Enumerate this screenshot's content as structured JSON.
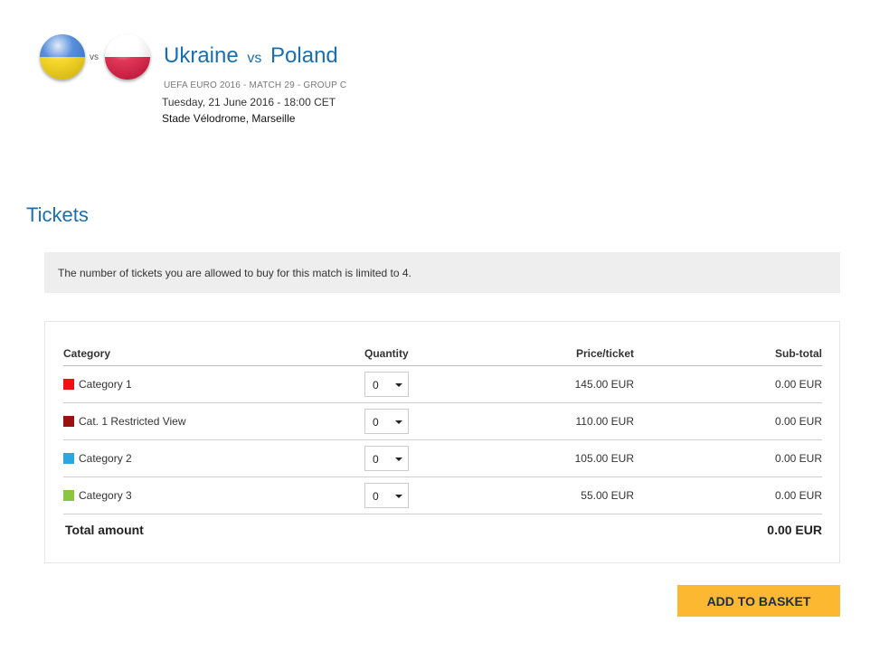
{
  "match": {
    "home_team": "Ukraine",
    "vs_label": "vs",
    "away_team": "Poland",
    "vs_small": "vs",
    "competition": "UEFA EURO 2016 - MATCH 29 - GROUP C",
    "datetime": "Tuesday, 21 June 2016 - 18:00 CET",
    "venue": "Stade Vélodrome, Marseille",
    "home_flag": {
      "icon": "ukraine-flag-icon",
      "colors": [
        "#3a7bd5",
        "#f6d20a"
      ]
    },
    "away_flag": {
      "icon": "poland-flag-icon",
      "colors": [
        "#ffffff",
        "#dc143c"
      ]
    }
  },
  "tickets": {
    "section_title": "Tickets",
    "notice": "The number of tickets you are allowed to buy for this match is limited to 4.",
    "headers": {
      "category": "Category",
      "quantity": "Quantity",
      "price": "Price/ticket",
      "subtotal": "Sub-total"
    },
    "rows": [
      {
        "category": "Category 1",
        "color": "#ee1111",
        "quantity": "0",
        "price": "145.00 EUR",
        "subtotal": "0.00 EUR"
      },
      {
        "category": "Cat. 1 Restricted View",
        "color": "#991111",
        "quantity": "0",
        "price": "110.00 EUR",
        "subtotal": "0.00 EUR"
      },
      {
        "category": "Category 2",
        "color": "#2aa7e0",
        "quantity": "0",
        "price": "105.00 EUR",
        "subtotal": "0.00 EUR"
      },
      {
        "category": "Category 3",
        "color": "#8cc63f",
        "quantity": "0",
        "price": "55.00 EUR",
        "subtotal": "0.00 EUR"
      }
    ],
    "total_label": "Total amount",
    "total_value": "0.00 EUR"
  },
  "basket_button": {
    "label": "ADD TO BASKET",
    "color": "#fbb830"
  },
  "colors": {
    "accent": "#1a6fb0",
    "notice_bg": "#eeeeee"
  }
}
